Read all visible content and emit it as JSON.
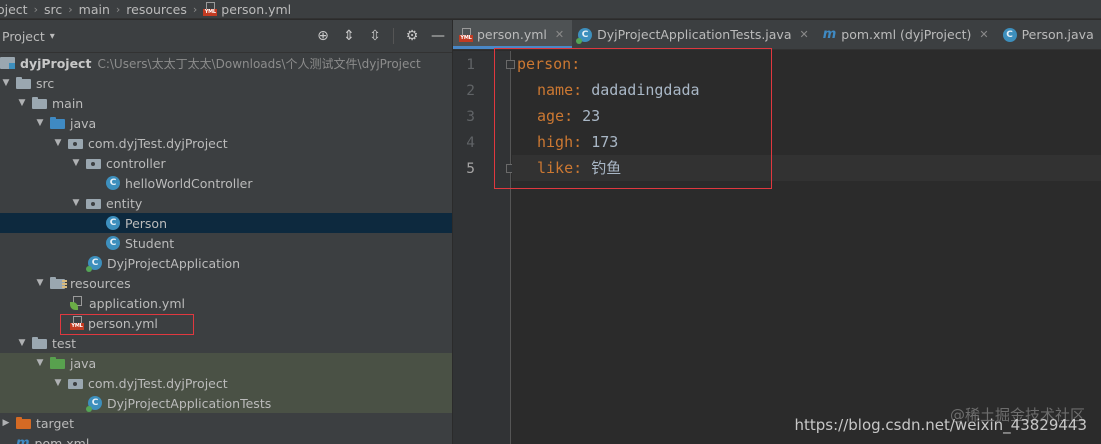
{
  "breadcrumb": {
    "items": [
      "oject",
      "src",
      "main",
      "resources",
      "person.yml"
    ]
  },
  "project_panel": {
    "title": "Project",
    "tools": [
      "target-icon",
      "expand-icon",
      "collapse-icon",
      "gear-icon",
      "minimize-icon"
    ],
    "tree": [
      {
        "label": "dyjProject",
        "path": "C:\\Users\\太太丁太太\\Downloads\\个人测试文件\\dyjProject"
      },
      {
        "label": "src"
      },
      {
        "label": "main"
      },
      {
        "label": "java"
      },
      {
        "label": "com.dyjTest.dyjProject"
      },
      {
        "label": "controller"
      },
      {
        "label": "helloWorldController"
      },
      {
        "label": "entity"
      },
      {
        "label": "Person"
      },
      {
        "label": "Student"
      },
      {
        "label": "DyjProjectApplication"
      },
      {
        "label": "resources"
      },
      {
        "label": "application.yml"
      },
      {
        "label": "person.yml"
      },
      {
        "label": "test"
      },
      {
        "label": "java"
      },
      {
        "label": "com.dyjTest.dyjProject"
      },
      {
        "label": "DyjProjectApplicationTests"
      },
      {
        "label": "target"
      },
      {
        "label": "pom.xml"
      }
    ]
  },
  "editor": {
    "tabs": [
      {
        "label": "person.yml",
        "active": true
      },
      {
        "label": "DyjProjectApplicationTests.java"
      },
      {
        "label": "pom.xml (dyjProject)"
      },
      {
        "label": "Person.java"
      }
    ],
    "line_numbers": [
      "1",
      "2",
      "3",
      "4",
      "5"
    ],
    "lines": [
      {
        "key": "person",
        "value": ""
      },
      {
        "key": "name",
        "value": "dadadingdada"
      },
      {
        "key": "age",
        "value": "23"
      },
      {
        "key": "high",
        "value": "173"
      },
      {
        "key": "like",
        "value": "钓鱼"
      }
    ]
  },
  "watermark": {
    "text": "https://blog.csdn.net/weixin_43829443",
    "overlay": "@稀土掘金技术社区"
  },
  "colors": {
    "highlight_box": "#e0383f",
    "selection": "#0d293e",
    "yaml_key": "#cc7832",
    "yaml_value": "#a9b7c6"
  }
}
